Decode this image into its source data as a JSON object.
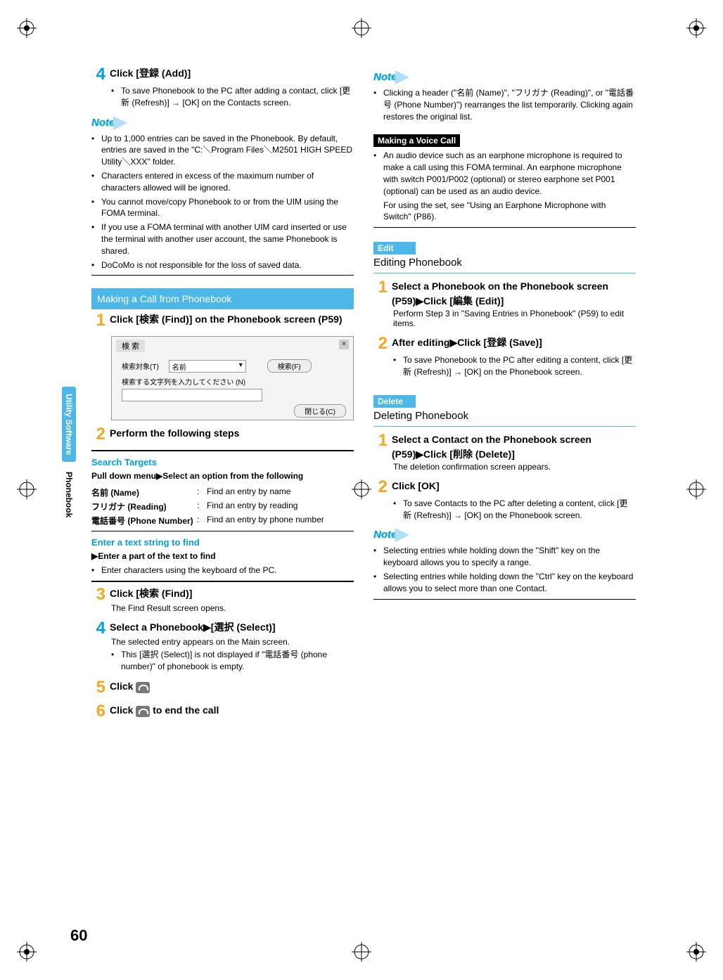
{
  "sidebar": {
    "tab1": "Utility Software",
    "tab2": "Phonebook"
  },
  "pageNumber": "60",
  "left": {
    "step4_num": "4",
    "step4_title": "Click [登録 (Add)]",
    "step4_bullet": "To save Phonebook to the PC after adding a contact, click [更新 (Refresh)] → [OK] on the Contacts screen.",
    "note_label": "Note",
    "note1": "Up to 1,000 entries can be saved in the Phonebook. By default, entries are saved in the \"C:＼Program Files＼M2501 HIGH SPEED Utility＼XXX\" folder.",
    "note2": "Characters entered in excess of the maximum number of characters allowed will be ignored.",
    "note3": "You cannot move/copy Phonebook to or from the UIM using the FOMA terminal.",
    "note4": "If you use a FOMA terminal with another UIM card inserted or use the terminal with another user account, the same Phonebook is shared.",
    "note5": "DoCoMo is not responsible for the loss of saved data.",
    "section_title": "Making a Call from Phonebook",
    "s1_num": "1",
    "s1_title": "Click [検索 (Find)] on the Phonebook screen (P59)",
    "dialog_title": "検 索",
    "dlg_label1": "検索対象(T)",
    "dlg_field_val": "名前",
    "dlg_btn_find": "検索(F)",
    "dlg_label2": "検索する文字列を入力してください (N)",
    "dlg_btn_close": "閉じる(C)",
    "s2_num": "2",
    "s2_title": "Perform the following steps",
    "search_targets": "Search Targets",
    "pulldown": "Pull down menu▶Select an option from the following",
    "row1a": "名前 (Name)",
    "row1b": "Find an entry by name",
    "row2a": "フリガナ (Reading)",
    "row2b": "Find an entry by reading",
    "row3a": "電話番号 (Phone Number)",
    "row3b": "Find an entry by phone number",
    "enter_head": "Enter a text string to find",
    "enter_b1": "▶Enter a part of the text to find",
    "enter_b2": "Enter characters using the keyboard of the PC.",
    "s3_num": "3",
    "s3_title": "Click [検索 (Find)]",
    "s3_body": "The Find Result screen opens.",
    "s4_num": "4",
    "s4_title": "Select a Phonebook▶[選択 (Select)]",
    "s4_body": "The selected entry appears on the Main screen.",
    "s4_bullet": "This [選択 (Select)] is not displayed if \"電話番号 (phone number)\" of phonebook is empty.",
    "s5_num": "5",
    "s5_title": "Click ",
    "s6_num": "6",
    "s6_title_a": "Click ",
    "s6_title_b": " to end the call"
  },
  "right": {
    "note_label": "Note",
    "noteA": "Clicking a header (\"名前 (Name)\", \"フリガナ (Reading)\", or \"電話番号 (Phone Number)\") rearranges the list temporarily. Clicking again restores the original list.",
    "making_head": "Making a Voice Call",
    "making_bullet": "An audio device such as an earphone microphone is required to make a call using this FOMA terminal. An earphone microphone with switch P001/P002 (optional) or stereo earphone set P001 (optional) can be used as an audio device.",
    "making_body2": "For using the set, see \"Using an Earphone Microphone with Switch\" (P86).",
    "edit_tag": "Edit",
    "edit_title": "Editing Phonebook",
    "e1_num": "1",
    "e1_title": "Select a Phonebook on the Phonebook screen (P59)▶Click [編集 (Edit)]",
    "e1_body": "Perform Step 3 in \"Saving Entries in Phonebook\" (P59) to edit items.",
    "e2_num": "2",
    "e2_title": "After editing▶Click [登録 (Save)]",
    "e2_bullet": "To save Phonebook to the PC after editing a content, click [更新 (Refresh)] → [OK] on the Phonebook screen.",
    "del_tag": "Delete",
    "del_title": "Deleting Phonebook",
    "d1_num": "1",
    "d1_title": "Select a Contact on the Phonebook screen (P59)▶Click [削除 (Delete)]",
    "d1_body": "The deletion confirmation screen appears.",
    "d2_num": "2",
    "d2_title": "Click [OK]",
    "d2_bullet": "To save Contacts to the PC after deleting a content, click [更新 (Refresh)] → [OK] on the Phonebook screen.",
    "noteB1": "Selecting entries while holding down the \"Shift\" key on the keyboard allows you to specify a range.",
    "noteB2": "Selecting entries while holding down the \"Ctrl\" key on the keyboard allows you to select more than one Contact."
  }
}
